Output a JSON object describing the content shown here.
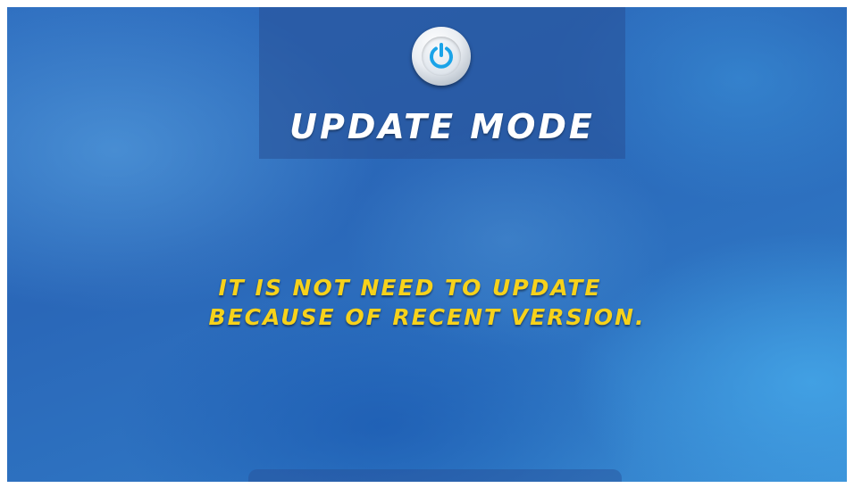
{
  "header": {
    "title": "UPDATE MODE",
    "icon": "power-icon"
  },
  "message": {
    "line1": "IT IS NOT NEED TO UPDATE",
    "line2": "BECAUSE OF RECENT VERSION."
  },
  "colors": {
    "background": "#2e6ebf",
    "title_text": "#ffffff",
    "message_text": "#f7d21b",
    "power_icon": "#1aa3e8"
  }
}
